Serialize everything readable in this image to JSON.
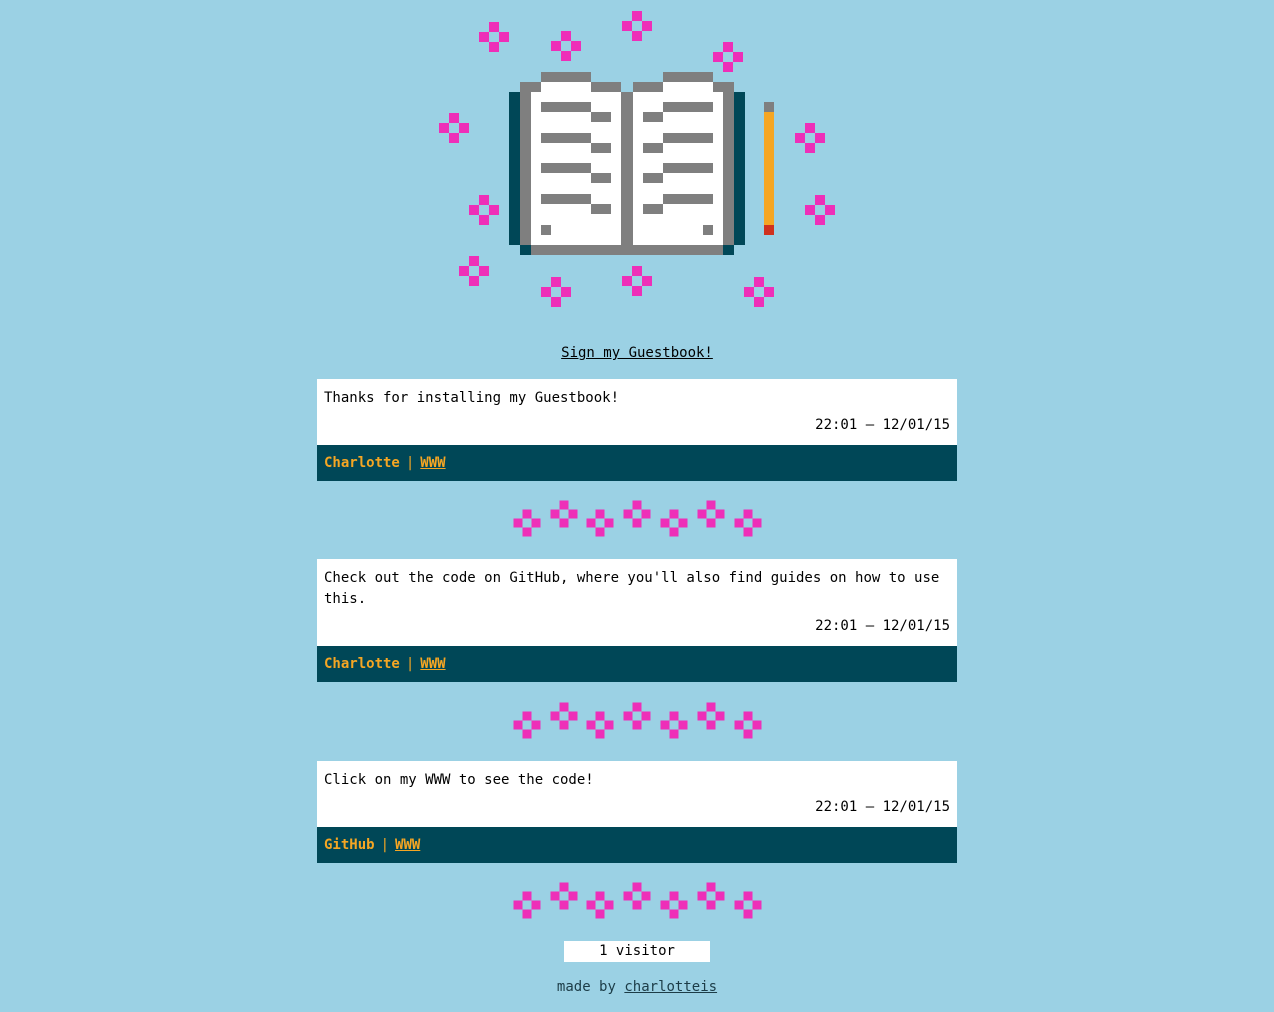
{
  "colors": {
    "background": "#9bd1e4",
    "sparkle": "#ee2fb8",
    "footer_bar": "#004757",
    "footer_text": "#f5a623",
    "book_page": "#ffffff",
    "book_outline": "#7f7f7f",
    "book_cover": "#004757",
    "pencil_body": "#f5a623",
    "pencil_tip": "#d0321e"
  },
  "hero": {
    "icon": "open-book-icon",
    "pencil_icon": "pencil-icon",
    "sparkle_icon": "sparkle-icon"
  },
  "sign_link": "Sign my Guestbook!",
  "entries": [
    {
      "message": "Thanks for installing my Guestbook!",
      "timestamp": "22:01 – 12/01/15",
      "author": "Charlotte",
      "separator": "|",
      "website": "WWW"
    },
    {
      "message": "Check out the code on GitHub, where you'll also find guides on how to use this.",
      "timestamp": "22:01 – 12/01/15",
      "author": "Charlotte",
      "separator": "|",
      "website": "WWW"
    },
    {
      "message": "Click on my WWW to see the code!",
      "timestamp": "22:01 – 12/01/15",
      "author": "GitHub",
      "separator": "|",
      "website": "WWW"
    }
  ],
  "counter": "1 visitor",
  "footer": {
    "prefix": "made by",
    "author_link": "charlotteis"
  }
}
